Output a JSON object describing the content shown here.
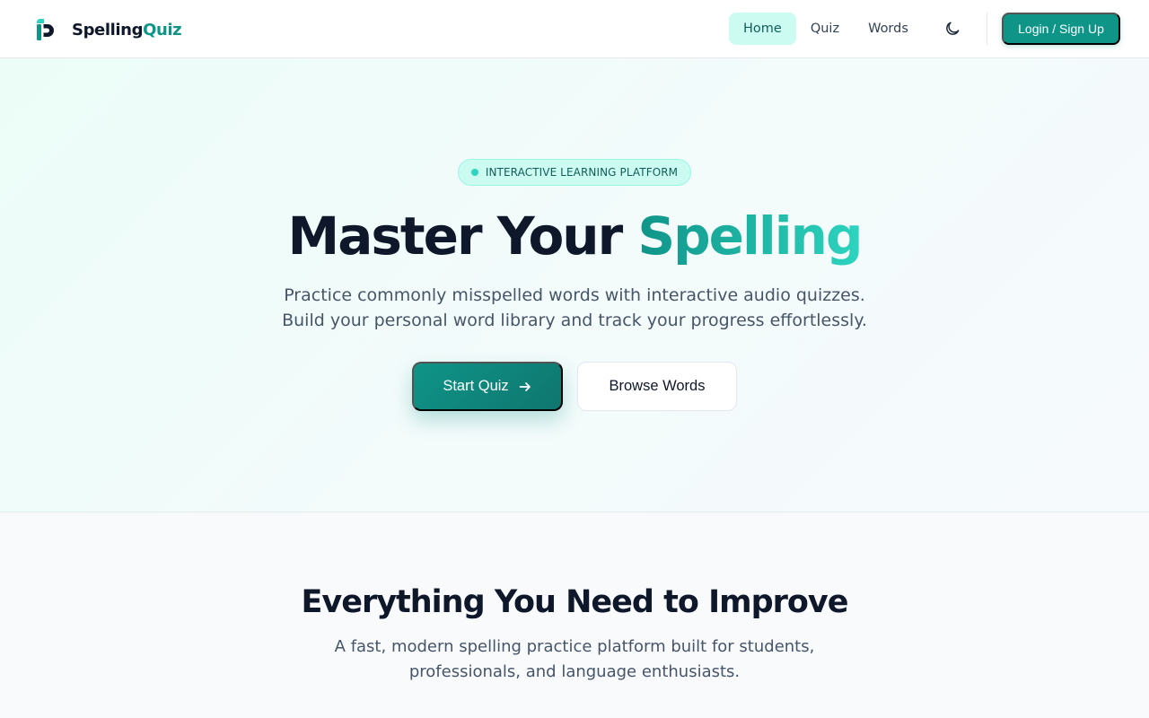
{
  "nav": {
    "brand_prefix": "Spelling",
    "brand_accent": "Quiz",
    "links": [
      {
        "label": "Home",
        "active": true
      },
      {
        "label": "Quiz",
        "active": false
      },
      {
        "label": "Words",
        "active": false
      }
    ],
    "theme_icon": "moon-icon",
    "login_label": "Login / Sign Up"
  },
  "hero": {
    "badge": "INTERACTIVE LEARNING PLATFORM",
    "title_prefix": "Master Your",
    "title_accent": "Spelling",
    "subtitle_line1": "Practice commonly misspelled words with interactive audio quizzes.",
    "subtitle_line2": "Build your personal word library and track your progress effortlessly.",
    "primary_cta": "Start Quiz",
    "primary_cta_icon": "arrow-right-icon",
    "secondary_cta": "Browse Words"
  },
  "features": {
    "title": "Everything You Need to Improve",
    "subtitle_line1": "A fast, modern spelling practice platform built for students,",
    "subtitle_line2": "professionals, and language enthusiasts."
  },
  "colors": {
    "accent": "#0f9488",
    "accent_light": "#2dd4bf",
    "badge_bg": "#ccfbf1",
    "text_dark": "#0f172a",
    "text_muted": "#475569"
  }
}
